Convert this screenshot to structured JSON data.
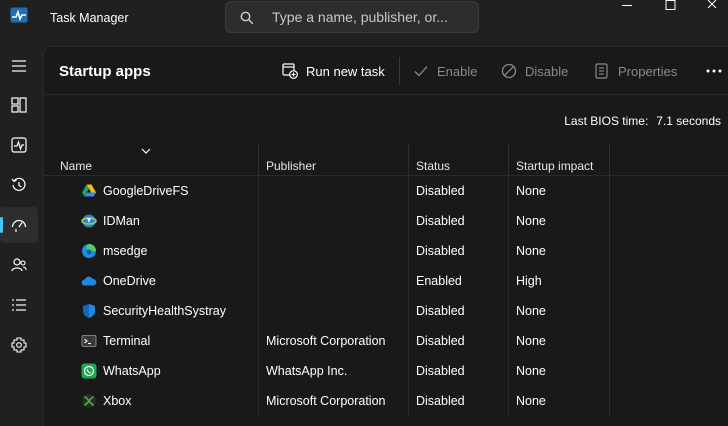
{
  "window": {
    "title": "Task Manager"
  },
  "search": {
    "placeholder": "Type a name, publisher, or..."
  },
  "nav": {
    "items": [
      {
        "name": "menu-icon"
      },
      {
        "name": "processes-icon"
      },
      {
        "name": "performance-icon"
      },
      {
        "name": "app-history-icon"
      },
      {
        "name": "startup-apps-icon",
        "active": true
      },
      {
        "name": "users-icon"
      },
      {
        "name": "details-icon"
      },
      {
        "name": "services-icon"
      }
    ]
  },
  "toolbar": {
    "title": "Startup apps",
    "run_new_task": "Run new task",
    "enable": "Enable",
    "disable": "Disable",
    "properties": "Properties"
  },
  "bios": {
    "label": "Last BIOS time:",
    "value": "7.1 seconds"
  },
  "table": {
    "columns": [
      "Name",
      "Publisher",
      "Status",
      "Startup impact"
    ],
    "rows": [
      {
        "icon": "google-drive-icon",
        "name": "GoogleDriveFS",
        "publisher": "",
        "status": "Disabled",
        "impact": "None"
      },
      {
        "icon": "idman-icon",
        "name": "IDMan",
        "publisher": "",
        "status": "Disabled",
        "impact": "None"
      },
      {
        "icon": "edge-icon",
        "name": "msedge",
        "publisher": "",
        "status": "Disabled",
        "impact": "None"
      },
      {
        "icon": "onedrive-icon",
        "name": "OneDrive",
        "publisher": "",
        "status": "Enabled",
        "impact": "High"
      },
      {
        "icon": "security-shield-icon",
        "name": "SecurityHealthSystray",
        "publisher": "",
        "status": "Disabled",
        "impact": "None"
      },
      {
        "icon": "terminal-icon",
        "name": "Terminal",
        "publisher": "Microsoft Corporation",
        "status": "Disabled",
        "impact": "None"
      },
      {
        "icon": "whatsapp-icon",
        "name": "WhatsApp",
        "publisher": "WhatsApp Inc.",
        "status": "Disabled",
        "impact": "None"
      },
      {
        "icon": "xbox-icon",
        "name": "Xbox",
        "publisher": "Microsoft Corporation",
        "status": "Disabled",
        "impact": "None"
      }
    ]
  }
}
